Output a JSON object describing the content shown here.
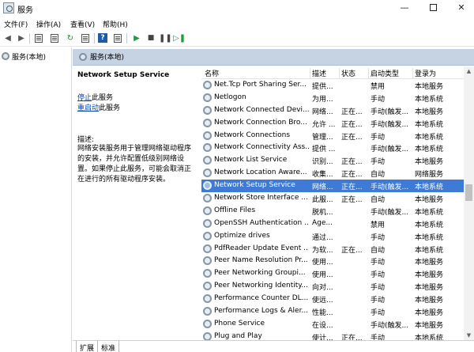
{
  "window": {
    "title": "服务"
  },
  "menu": [
    "文件(F)",
    "操作(A)",
    "查看(V)",
    "帮助(H)"
  ],
  "tree": {
    "root_label": "服务(本地)"
  },
  "band": {
    "label": "服务(本地)"
  },
  "detail": {
    "service_title": "Network Setup Service",
    "stop_link": "停止",
    "stop_suffix": "此服务",
    "restart_link": "重启动",
    "restart_suffix": "此服务",
    "description_label": "描述:",
    "description": "网络安装服务用于管理网络驱动程序的安装，并允许配置低级别网络设置。如果停止此服务，可能会取消正在进行的所有驱动程序安装。"
  },
  "columns": {
    "name": "名称",
    "desc": "描述",
    "status": "状态",
    "startup": "启动类型",
    "logon": "登录为"
  },
  "rows": [
    {
      "name": "Net.Tcp Port Sharing Ser...",
      "desc": "提供...",
      "status": "",
      "startup": "禁用",
      "logon": "本地服务"
    },
    {
      "name": "Netlogon",
      "desc": "为用...",
      "status": "",
      "startup": "手动",
      "logon": "本地系统"
    },
    {
      "name": "Network Connected Devi...",
      "desc": "网络...",
      "status": "正在...",
      "startup": "手动(触发...",
      "logon": "本地服务"
    },
    {
      "name": "Network Connection Bro...",
      "desc": "允许 ...",
      "status": "正在...",
      "startup": "手动(触发...",
      "logon": "本地系统"
    },
    {
      "name": "Network Connections",
      "desc": "管理...",
      "status": "正在...",
      "startup": "手动",
      "logon": "本地系统"
    },
    {
      "name": "Network Connectivity Ass...",
      "desc": "提供 ...",
      "status": "",
      "startup": "手动(触发...",
      "logon": "本地系统"
    },
    {
      "name": "Network List Service",
      "desc": "识别...",
      "status": "正在...",
      "startup": "手动",
      "logon": "本地服务"
    },
    {
      "name": "Network Location Aware...",
      "desc": "收集...",
      "status": "正在...",
      "startup": "自动",
      "logon": "网络服务"
    },
    {
      "name": "Network Setup Service",
      "desc": "网络...",
      "status": "正在...",
      "startup": "手动(触发...",
      "logon": "本地系统",
      "selected": true
    },
    {
      "name": "Network Store Interface ...",
      "desc": "此服...",
      "status": "正在...",
      "startup": "自动",
      "logon": "本地服务"
    },
    {
      "name": "Offline Files",
      "desc": "脱机...",
      "status": "",
      "startup": "手动(触发...",
      "logon": "本地系统"
    },
    {
      "name": "OpenSSH Authentication ...",
      "desc": "Age...",
      "status": "",
      "startup": "禁用",
      "logon": "本地系统"
    },
    {
      "name": "Optimize drives",
      "desc": "通过...",
      "status": "",
      "startup": "手动",
      "logon": "本地系统"
    },
    {
      "name": "PdfReader Update Event ...",
      "desc": "为软...",
      "status": "正在...",
      "startup": "自动",
      "logon": "本地系统"
    },
    {
      "name": "Peer Name Resolution Pr...",
      "desc": "使用...",
      "status": "",
      "startup": "手动",
      "logon": "本地服务"
    },
    {
      "name": "Peer Networking Groupi...",
      "desc": "使用...",
      "status": "",
      "startup": "手动",
      "logon": "本地服务"
    },
    {
      "name": "Peer Networking Identity...",
      "desc": "向对...",
      "status": "",
      "startup": "手动",
      "logon": "本地服务"
    },
    {
      "name": "Performance Counter DL...",
      "desc": "使远...",
      "status": "",
      "startup": "手动",
      "logon": "本地服务"
    },
    {
      "name": "Performance Logs & Aler...",
      "desc": "性能...",
      "status": "",
      "startup": "手动",
      "logon": "本地服务"
    },
    {
      "name": "Phone Service",
      "desc": "在设...",
      "status": "",
      "startup": "手动(触发...",
      "logon": "本地服务"
    },
    {
      "name": "Plug and Play",
      "desc": "使计...",
      "status": "正在...",
      "startup": "手动",
      "logon": "本地系统"
    }
  ],
  "tabs": [
    "扩展",
    "标准"
  ],
  "icons": [
    "back-arrow-icon",
    "forward-arrow-icon",
    "console-tree-icon",
    "properties-icon",
    "refresh-icon",
    "export-list-icon",
    "help-icon",
    "show-pane-icon",
    "play-icon",
    "stop-icon",
    "pause-icon",
    "restart-icon"
  ],
  "colors": {
    "selection": "#3e7ad6",
    "header_band": "#c5d3e2",
    "play": "#1e9e3a",
    "link": "#0645ad"
  }
}
